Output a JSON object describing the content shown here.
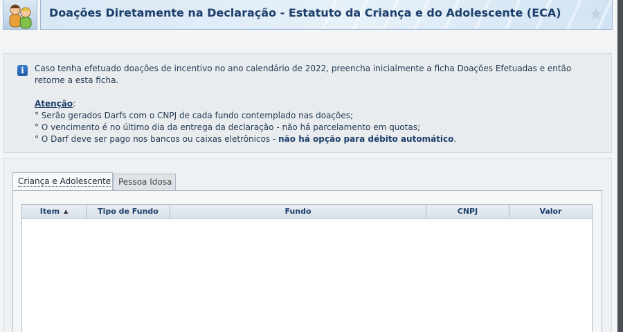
{
  "header": {
    "title": "Doações Diretamente na Declaração - Estatuto da Criança e do Adolescente (ECA)",
    "icon": "people-icon",
    "favorite_icon": "star-icon"
  },
  "info": {
    "icon": "info-icon",
    "message": "Caso tenha efetuado doações de incentivo no ano calendário de 2022, preencha inicialmente a ficha Doações Efetuadas e então retorne a esta ficha.",
    "attention_title": "Atenção",
    "attention_colon": ":",
    "bullets": [
      "° Serão gerados Darfs com o CNPJ de cada fundo contemplado nas doações;",
      "° O vencimento é no último dia da entrega da declaração - não há parcelamento em quotas;",
      "° O Darf deve ser pago nos bancos ou caixas eletrônicos - "
    ],
    "bullet_3_strong": "não há opção para débito automático",
    "bullet_3_end": "."
  },
  "tabs": [
    {
      "label": "Criança e Adolescente",
      "active": true
    },
    {
      "label": "Pessoa Idosa",
      "active": false
    }
  ],
  "table": {
    "columns": [
      "Item",
      "Tipo de Fundo",
      "Fundo",
      "CNPJ",
      "Valor"
    ],
    "sort_column": "Item",
    "sort_direction": "ascending",
    "rows": []
  }
}
